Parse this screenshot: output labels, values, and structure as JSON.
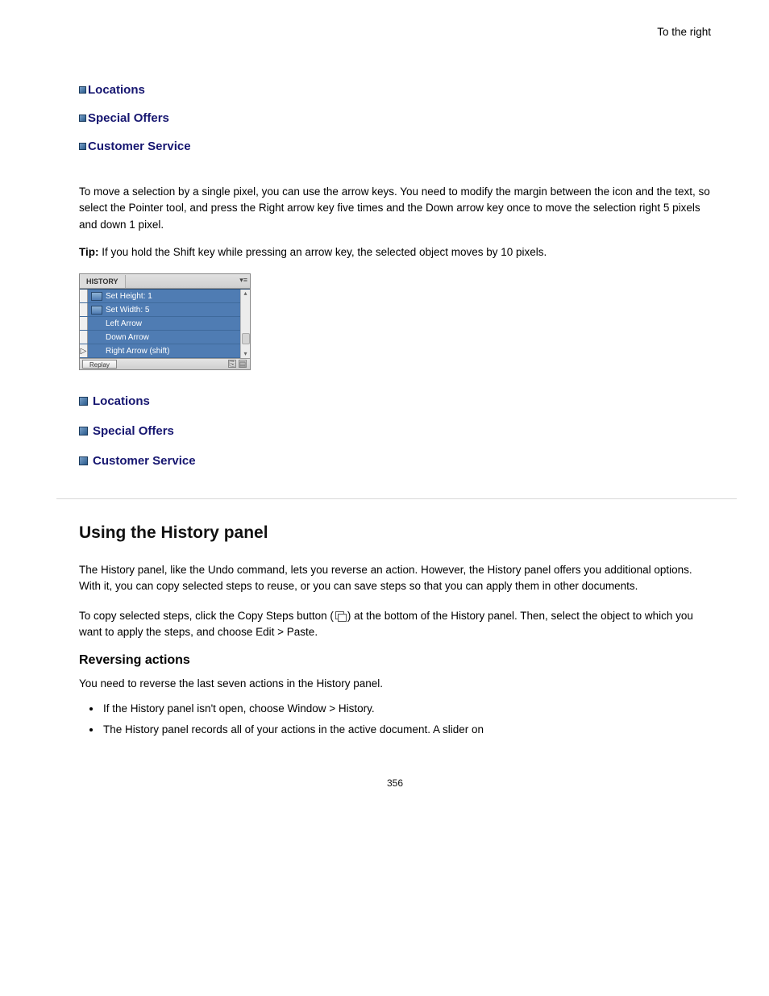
{
  "rightText": "To the right",
  "nav1": {
    "items": [
      "Locations",
      "Special Offers",
      "Customer Service"
    ]
  },
  "para1": "To move a selection by a single pixel, you can use the arrow keys. You need to modify the margin between the icon and the text, so select the Pointer tool, and press the Right arrow key five times and the Down arrow key once to move the selection right 5 pixels and down 1 pixel.",
  "tipLabel": "Tip:",
  "tipText": " If you hold the Shift key while pressing an arrow key, the selected object moves by 10 pixels.",
  "panel": {
    "title": "HISTORY",
    "rows": [
      {
        "icon": true,
        "label": "Set Height: 1"
      },
      {
        "icon": true,
        "label": "Set Width: 5"
      },
      {
        "icon": false,
        "label": "Left Arrow"
      },
      {
        "icon": false,
        "label": "Down Arrow"
      },
      {
        "icon": false,
        "pointer": true,
        "label": "Right Arrow (shift)"
      }
    ],
    "footer": "Replay"
  },
  "nav2": {
    "items": [
      "Locations",
      "Special Offers",
      "Customer Service"
    ]
  },
  "h2": "Using the History panel",
  "para2a": "The History panel, like the Undo command, lets you reverse an action. However, the History panel offers you additional options. With it, you can copy selected steps to reuse, or you can save steps so that you can apply them in other documents.",
  "para2b_1": "To copy selected steps, click the Copy Steps button (",
  "para2b_2": ") at the bottom of the History panel. Then, select the object to which you want to apply the steps, and choose Edit > Paste.",
  "h3": "Reversing actions",
  "para3": "You need to reverse the last seven actions in the History panel.",
  "list": [
    "If the History panel isn't open, choose Window > History.",
    "The History panel records all of your actions in the active document. A slider on"
  ],
  "pageNum": "356"
}
